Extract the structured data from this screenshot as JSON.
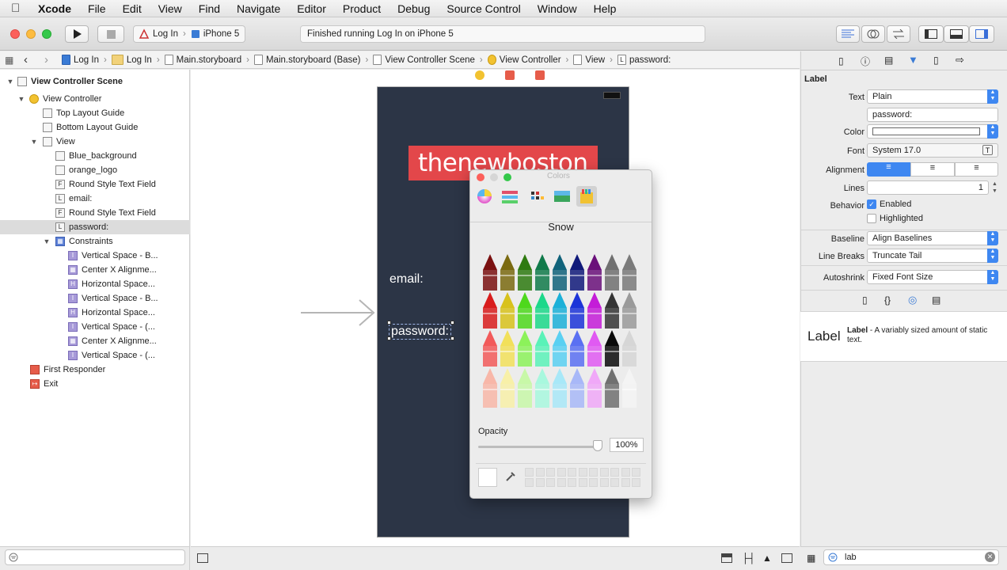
{
  "menu": {
    "items": [
      "Xcode",
      "File",
      "Edit",
      "View",
      "Find",
      "Navigate",
      "Editor",
      "Product",
      "Debug",
      "Source Control",
      "Window",
      "Help"
    ]
  },
  "toolbar": {
    "scheme_target": "Log In",
    "scheme_device": "iPhone 5",
    "status_text": "Finished running Log In on iPhone 5"
  },
  "jumpbar": {
    "crumbs": [
      "Log In",
      "Log In",
      "Main.storyboard",
      "Main.storyboard (Base)",
      "View Controller Scene",
      "View Controller",
      "View",
      "password:"
    ]
  },
  "navigator": {
    "rows": [
      {
        "label": "View Controller Scene",
        "icon": "scene-icon"
      },
      {
        "label": "View Controller",
        "icon": "view-controller-icon"
      },
      {
        "label": "Top Layout Guide",
        "icon": "layout-guide-icon"
      },
      {
        "label": "Bottom Layout Guide",
        "icon": "layout-guide-icon"
      },
      {
        "label": "View",
        "icon": "view-icon"
      },
      {
        "label": "Blue_background",
        "icon": "image-view-icon"
      },
      {
        "label": "orange_logo",
        "icon": "image-view-icon"
      },
      {
        "label": "Round Style Text Field",
        "icon": "text-field-icon"
      },
      {
        "label": "email:",
        "icon": "label-icon"
      },
      {
        "label": "Round Style Text Field",
        "icon": "text-field-icon"
      },
      {
        "label": "password:",
        "icon": "label-icon"
      },
      {
        "label": "Constraints",
        "icon": "constraints-icon"
      },
      {
        "label": "Vertical Space - B...",
        "icon": "constraint-icon"
      },
      {
        "label": "Center X Alignme...",
        "icon": "constraint-icon"
      },
      {
        "label": "Horizontal Space...",
        "icon": "constraint-icon"
      },
      {
        "label": "Vertical Space - B...",
        "icon": "constraint-icon"
      },
      {
        "label": "Horizontal Space...",
        "icon": "constraint-icon"
      },
      {
        "label": "Vertical Space - (...",
        "icon": "constraint-icon"
      },
      {
        "label": "Center X Alignme...",
        "icon": "constraint-icon"
      },
      {
        "label": "Vertical Space - (...",
        "icon": "constraint-icon"
      },
      {
        "label": "First Responder",
        "icon": "first-responder-icon"
      },
      {
        "label": "Exit",
        "icon": "exit-icon"
      }
    ]
  },
  "canvas": {
    "logo_text": "thenewboston",
    "email_label": "email:",
    "password_label": "password:"
  },
  "colors_panel": {
    "title": "Colors",
    "color_name": "Snow",
    "opacity_label": "Opacity",
    "opacity_value": "100%",
    "crayon_colors": [
      [
        "#7a1010",
        "#7a6a10",
        "#2e7a10",
        "#107a4a",
        "#10627a",
        "#101a7a",
        "#6a107a",
        "#707070",
        "#7a7a7a"
      ],
      [
        "#d81c1c",
        "#d8c21c",
        "#4ed81c",
        "#1cd88a",
        "#1cb0d8",
        "#1c34d8",
        "#c41cd8",
        "#353535",
        "#9a9a9a"
      ],
      [
        "#f25a5a",
        "#f2e05a",
        "#8cf25a",
        "#5af2b8",
        "#5ad0f2",
        "#5a70f2",
        "#e05af2",
        "#0a0a0a",
        "#d6d6d6"
      ],
      [
        "#f8b7a8",
        "#f8f0a8",
        "#c8f8a8",
        "#a8f8de",
        "#a8e8f8",
        "#a8b8f8",
        "#f0a8f8",
        "#707070",
        "#f4f4f4"
      ]
    ]
  },
  "inspector": {
    "section_title": "Label",
    "text_label": "Text",
    "text_value": "Plain",
    "text_content": "password:",
    "color_label": "Color",
    "font_label": "Font",
    "font_value": "System 17.0",
    "alignment_label": "Alignment",
    "lines_label": "Lines",
    "lines_value": "1",
    "behavior_label": "Behavior",
    "enabled_label": "Enabled",
    "enabled_checked": true,
    "highlighted_label": "Highlighted",
    "baseline_label": "Baseline",
    "baseline_value": "Align Baselines",
    "linebreaks_label": "Line Breaks",
    "linebreaks_value": "Truncate Tail",
    "autoshrink_label": "Autoshrink",
    "autoshrink_value": "Fixed Font Size",
    "library_item_title": "Label",
    "library_item_name": "Label",
    "library_item_desc": " - A variably sized amount of static text.",
    "filter_value": "lab"
  }
}
